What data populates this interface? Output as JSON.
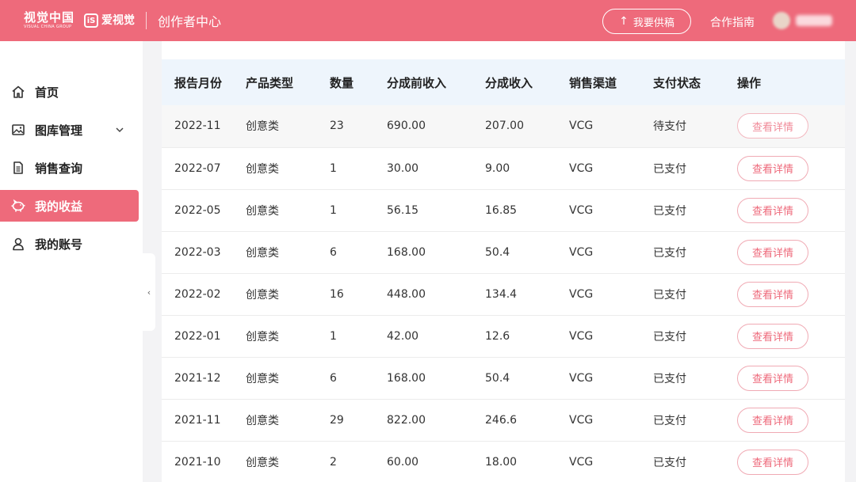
{
  "header": {
    "logo_vcg_cn": "视觉中国",
    "logo_vcg_en": "VISUAL CHINA GROUP",
    "logo_ashi_cn": "爱视觉",
    "logo_ashi_mark": "iS",
    "title": "创作者中心",
    "submit_label": "我要供稿",
    "guide_label": "合作指南",
    "brand_color": "#ee6a7b"
  },
  "sidebar": {
    "items": [
      {
        "label": "首页",
        "icon": "home-icon"
      },
      {
        "label": "图库管理",
        "icon": "image-icon",
        "has_submenu": true
      },
      {
        "label": "销售查询",
        "icon": "document-icon"
      },
      {
        "label": "我的收益",
        "icon": "piggy-bank-icon",
        "active": true
      },
      {
        "label": "我的账号",
        "icon": "user-icon"
      }
    ],
    "collapse_glyph": "‹"
  },
  "table": {
    "headers": [
      "报告月份",
      "产品类型",
      "数量",
      "分成前收入",
      "分成收入",
      "销售渠道",
      "支付状态",
      "操作"
    ],
    "action_label": "查看详情",
    "rows": [
      {
        "month": "2022-11",
        "type": "创意类",
        "qty": "23",
        "pre": "690.00",
        "share": "207.00",
        "channel": "VCG",
        "status": "待支付"
      },
      {
        "month": "2022-07",
        "type": "创意类",
        "qty": "1",
        "pre": "30.00",
        "share": "9.00",
        "channel": "VCG",
        "status": "已支付"
      },
      {
        "month": "2022-05",
        "type": "创意类",
        "qty": "1",
        "pre": "56.15",
        "share": "16.85",
        "channel": "VCG",
        "status": "已支付"
      },
      {
        "month": "2022-03",
        "type": "创意类",
        "qty": "6",
        "pre": "168.00",
        "share": "50.4",
        "channel": "VCG",
        "status": "已支付"
      },
      {
        "month": "2022-02",
        "type": "创意类",
        "qty": "16",
        "pre": "448.00",
        "share": "134.4",
        "channel": "VCG",
        "status": "已支付"
      },
      {
        "month": "2022-01",
        "type": "创意类",
        "qty": "1",
        "pre": "42.00",
        "share": "12.6",
        "channel": "VCG",
        "status": "已支付"
      },
      {
        "month": "2021-12",
        "type": "创意类",
        "qty": "6",
        "pre": "168.00",
        "share": "50.4",
        "channel": "VCG",
        "status": "已支付"
      },
      {
        "month": "2021-11",
        "type": "创意类",
        "qty": "29",
        "pre": "822.00",
        "share": "246.6",
        "channel": "VCG",
        "status": "已支付"
      },
      {
        "month": "2021-10",
        "type": "创意类",
        "qty": "2",
        "pre": "60.00",
        "share": "18.00",
        "channel": "VCG",
        "status": "已支付"
      }
    ]
  }
}
